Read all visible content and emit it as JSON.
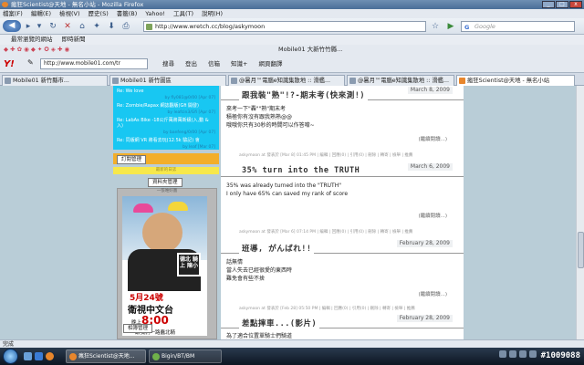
{
  "window": {
    "title": "瘋狂Scientist@天地 - 無名小站 - Mozilla Firefox",
    "min": "_",
    "max": "□",
    "close": "x"
  },
  "menu": [
    "檔案(F)",
    "編輯(E)",
    "檢視(V)",
    "歷史(S)",
    "書籤(B)",
    "Yahoo!",
    "工具(T)",
    "說明(H)"
  ],
  "nav": {
    "url": "http://www.wretch.cc/blog/askymoon",
    "search_placeholder": "Google",
    "search_logo": "G"
  },
  "bookmarks": [
    "最常瀏覽的網站",
    "即時新聞"
  ],
  "toolbar2": {
    "center_text": "Mobile01 大新竹竹縣..."
  },
  "toolbar3": {
    "logo": "Y!",
    "url": "http://www.mobile01.com/tr",
    "items": [
      "搜尋",
      "登出",
      "信箱",
      "知識+",
      "網頁翻譯"
    ]
  },
  "tabs": [
    {
      "label": "Mobile01 新竹縣市..."
    },
    {
      "label": "Mobile01 新竹圖區"
    },
    {
      "label": "@暑月™電腦e知識集散地 :: 滑艦..."
    },
    {
      "label": "瘋狂Scientist@天地 - 無名小站"
    }
  ],
  "sidebar": {
    "comments": [
      {
        "title": "Re: We love",
        "by": "by fly081@0/00 [Apr 07]"
      },
      {
        "title": "Re: Zombie/Rapax 網誌翻版(Gfi 開發)",
        "by": "by leafcin3/Gfi [Apr 07]"
      },
      {
        "title": "Re: LabAs Bike -18公斤萬將萬新級(入,動 & 入)",
        "by": "by banfeng/0/00 [Apr 07]"
      },
      {
        "title": "Re: 同版網 VR 將看去玩(12.5k 驗記) 會",
        "by": "by leaf [Mar 07]"
      }
    ],
    "subscribe_btn": "訂閱管理",
    "yellow_text": "最新的日誌",
    "manage_btn": "資料夾管理",
    "album_head": "一張唯好圖",
    "poster": {
      "stamp": "德北 騎上 陳小",
      "date": "5月24號",
      "channel": "衛視中文台",
      "time_prefix": "晚上",
      "time": "8:00",
      "tagline": "跟我們一路蠢北騎"
    },
    "album_btn": "相簿管理"
  },
  "posts": [
    {
      "date": "March 8, 2009",
      "title": "跟我裝\"熟\"!?-期末考(快來測!)",
      "body": [
        "來考一下\"轟\"\"熟\"期末考",
        "積極你有沒有跟我熟熟@@",
        "哦哦你只有30秒的時間可以作答唷~"
      ],
      "more": "(繼續閱讀...)",
      "foot": "askymoon at 發表於 [Mar 8] 01:45 PM | 編輯 | 回應(0) | 引用(0) | 刪除 | 轉寄 | 檢舉 | 推薦"
    },
    {
      "date": "March 6, 2009",
      "title": "35% turn into the TRUTH",
      "body": [
        "35% was already turned into the \"TRUTH\"",
        "I only have 65% can saved my rank of score"
      ],
      "more": "(繼續閱讀...)",
      "foot": "askymoon at 發表於 [Mar 6] 07:14 PM | 編輯 | 回應(0) | 引用(0) | 刪除 | 轉寄 | 檢舉 | 推薦"
    },
    {
      "date": "February 28, 2009",
      "title": "班導, がんばれ!!",
      "body": [
        "話無情",
        "當人失去已經很愛的東西時",
        "難免會有些不捨"
      ],
      "more": "(繼續閱讀...)",
      "foot": "askymoon at 發表於 [Feb 28] 05:50 PM | 編輯 | 回應(0) | 引用(0) | 刪除 | 轉寄 | 檢舉 | 推薦"
    },
    {
      "date": "February 28, 2009",
      "title": "差點摔車...(影片)",
      "body": [
        "為了適合位置單騎士們騎道"
      ],
      "more": "",
      "foot": ""
    }
  ],
  "status": "完成",
  "taskbar": {
    "tasks": [
      "瘋狂Scientist@天地...",
      "Bigin/BT/BM"
    ],
    "clock": "#1009088"
  }
}
